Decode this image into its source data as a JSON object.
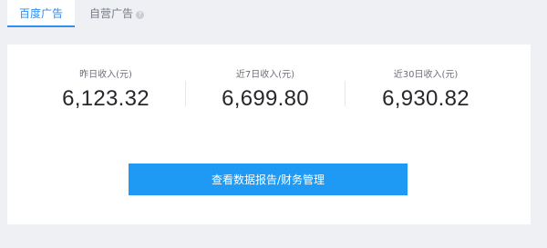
{
  "tabs": {
    "active_label": "百度广告",
    "inactive_label": "自营广告",
    "info_icon": "info-icon"
  },
  "stats": [
    {
      "label": "昨日收入(元)",
      "value": "6,123.32"
    },
    {
      "label": "近7日收入(元)",
      "value": "6,699.80"
    },
    {
      "label": "近30日收入(元)",
      "value": "6,930.82"
    }
  ],
  "actions": {
    "report_button_label": "查看数据报告/财务管理"
  },
  "colors": {
    "accent": "#2f8ef0",
    "button": "#1e9af5",
    "background": "#eff0f3"
  }
}
